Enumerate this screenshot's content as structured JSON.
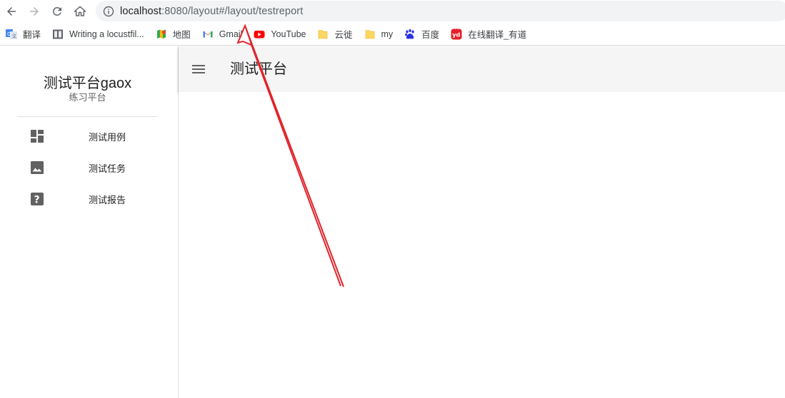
{
  "browser": {
    "url_host": "localhost",
    "url_port": ":8080",
    "url_path": "/layout#/layout/testreport"
  },
  "bookmarks": [
    {
      "label": "翻译",
      "icon": "google-translate-icon"
    },
    {
      "label": "Writing a locustfil...",
      "icon": "book-icon"
    },
    {
      "label": "地图",
      "icon": "google-maps-icon"
    },
    {
      "label": "Gmail",
      "icon": "gmail-icon"
    },
    {
      "label": "YouTube",
      "icon": "youtube-icon"
    },
    {
      "label": "云徙",
      "icon": "folder-icon"
    },
    {
      "label": "my",
      "icon": "folder-icon"
    },
    {
      "label": "百度",
      "icon": "baidu-icon"
    },
    {
      "label": "在线翻译_有道",
      "icon": "youdao-icon"
    }
  ],
  "sidebar": {
    "brand_title": "测试平台gaox",
    "brand_subtitle": "练习平台",
    "items": [
      {
        "label": "测试用例",
        "icon": "dashboard-icon"
      },
      {
        "label": "测试任务",
        "icon": "image-icon"
      },
      {
        "label": "测试报告",
        "icon": "help-icon"
      }
    ]
  },
  "appbar": {
    "title": "测试平台"
  },
  "colors": {
    "appbar_bg": "#f5f5f5",
    "annotation_arrow": "#e0242b",
    "icon_grey": "#616161"
  }
}
